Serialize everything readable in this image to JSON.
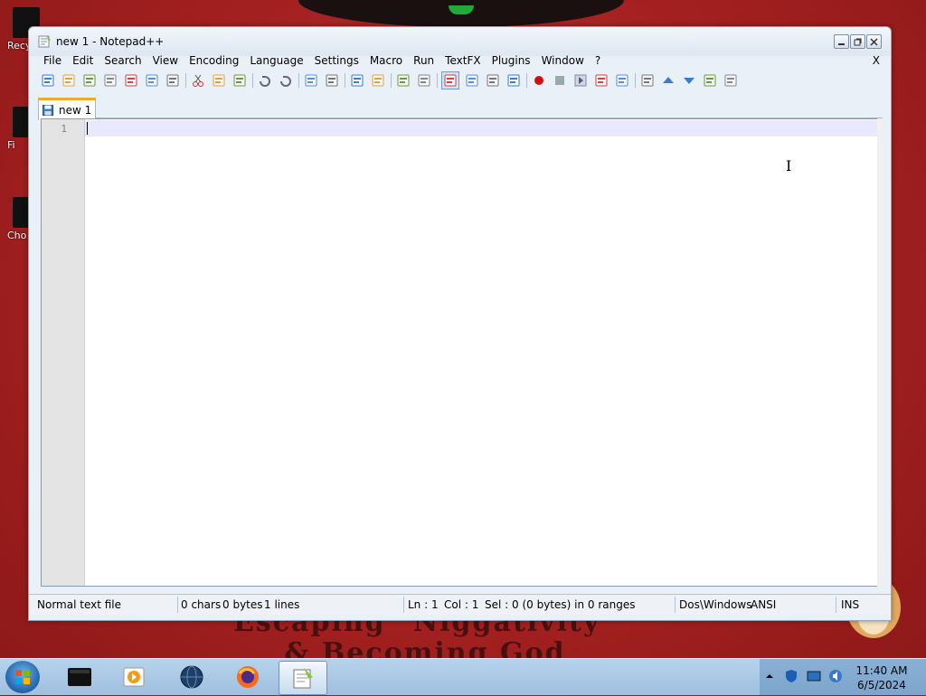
{
  "window": {
    "title": "new 1 - Notepad++"
  },
  "menu": [
    "File",
    "Edit",
    "Search",
    "View",
    "Encoding",
    "Language",
    "Settings",
    "Macro",
    "Run",
    "TextFX",
    "Plugins",
    "Window",
    "?"
  ],
  "menu_close": "X",
  "toolbar": [
    "new-file-icon",
    "open-file-icon",
    "save-icon",
    "save-all-icon",
    "close-icon",
    "close-all-icon",
    "print-icon",
    "|",
    "cut-icon",
    "copy-icon",
    "paste-icon",
    "|",
    "undo-icon",
    "redo-icon",
    "|",
    "find-icon",
    "replace-icon",
    "|",
    "zoom-in-icon",
    "zoom-out-icon",
    "|",
    "sync-vertical-icon",
    "sync-horizontal-icon",
    "|",
    "word-wrap-icon",
    "show-all-chars-icon",
    "indent-guide-icon",
    "user-lang-icon",
    "|",
    "record-macro-icon",
    "stop-macro-icon",
    "play-macro-icon",
    "run-macro-multiple-icon",
    "save-macro-icon",
    "|",
    "collapse-icon",
    "prev-icon",
    "next-icon",
    "expand-icon",
    "spellcheck-icon"
  ],
  "tab": {
    "label": "new 1"
  },
  "editor": {
    "line_numbers": [
      "1"
    ]
  },
  "status": {
    "file_type": "Normal text file",
    "chars": "0 chars",
    "bytes": "0 bytes",
    "lines": "1 lines",
    "ln": "Ln : 1",
    "col": "Col : 1",
    "sel": "Sel : 0 (0 bytes) in 0 ranges",
    "eol": "Dos\\Windows",
    "encoding": "ANSI",
    "mode": "INS"
  },
  "desktop": {
    "icons": [
      "Recy",
      "Fi",
      "Cho"
    ],
    "wallpaper_text": [
      "Escaping \"Niggativity\"",
      "& Becoming God"
    ]
  },
  "taskbar": {
    "clock_time": "11:40 AM",
    "clock_date": "6/5/2024"
  },
  "colors": {
    "accent_tab": "#f5a623",
    "current_line": "#e8e8ff",
    "desktop": "#a42020"
  }
}
